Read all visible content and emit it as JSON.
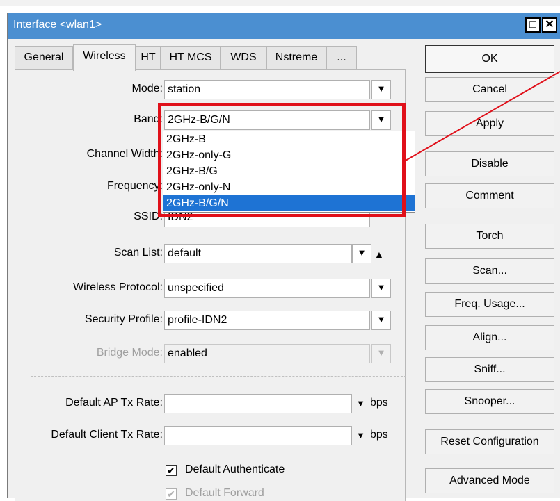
{
  "window": {
    "title": "Interface <wlan1>"
  },
  "tabs": [
    "General",
    "Wireless",
    "HT",
    "HT MCS",
    "WDS",
    "Nstreme",
    "..."
  ],
  "active_tab": "Wireless",
  "fields": {
    "mode": {
      "label": "Mode:",
      "value": "station"
    },
    "band": {
      "label": "Band:",
      "value": "2GHz-B/G/N"
    },
    "channel_width": {
      "label": "Channel Width:"
    },
    "frequency": {
      "label": "Frequency:"
    },
    "ssid": {
      "label": "SSID:",
      "value": "IDN2"
    },
    "scan_list": {
      "label": "Scan List:",
      "value": "default"
    },
    "wireless_protocol": {
      "label": "Wireless Protocol:",
      "value": "unspecified"
    },
    "security_profile": {
      "label": "Security Profile:",
      "value": "profile-IDN2"
    },
    "bridge_mode": {
      "label": "Bridge Mode:",
      "value": "enabled"
    },
    "default_ap_tx_rate": {
      "label": "Default AP Tx Rate:",
      "value": "",
      "unit": "bps"
    },
    "default_client_tx_rate": {
      "label": "Default Client Tx Rate:",
      "value": "",
      "unit": "bps"
    }
  },
  "checkboxes": {
    "default_authenticate": {
      "label": "Default Authenticate",
      "checked": true
    },
    "default_forward": {
      "label": "Default Forward",
      "checked": true
    }
  },
  "band_dropdown": {
    "options": [
      "2GHz-B",
      "2GHz-only-G",
      "2GHz-B/G",
      "2GHz-only-N",
      "2GHz-B/G/N"
    ],
    "selected": "2GHz-B/G/N"
  },
  "buttons": {
    "ok": "OK",
    "cancel": "Cancel",
    "apply": "Apply",
    "disable": "Disable",
    "comment": "Comment",
    "torch": "Torch",
    "scan": "Scan...",
    "freq_usage": "Freq. Usage...",
    "align": "Align...",
    "sniff": "Sniff...",
    "snooper": "Snooper...",
    "reset_configuration": "Reset Configuration",
    "advanced_mode": "Advanced Mode"
  },
  "colors": {
    "titlebar": "#4b8fd1",
    "selection": "#1e73d4",
    "highlight": "#e0101a"
  }
}
